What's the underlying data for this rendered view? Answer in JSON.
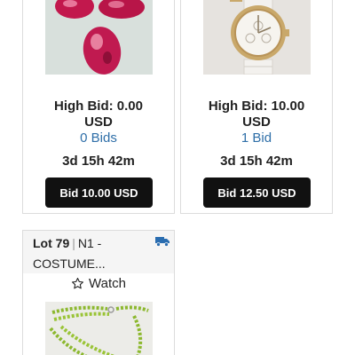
{
  "lots": [
    {
      "image_icon": "ruby-gemstones-photo",
      "high_bid_label": "High Bid: 0.00",
      "currency": "USD",
      "bids": "0 Bids",
      "time_left": "3d 15h 42m",
      "bid_button": "Bid 10.00 USD"
    },
    {
      "image_icon": "wristwatch-photo",
      "high_bid_label": "High Bid: 10.00",
      "currency": "USD",
      "bids": "1 Bid",
      "time_left": "3d 15h 42m",
      "bid_button": "Bid 12.50 USD"
    },
    {
      "lot_number": "Lot 79",
      "title_line1": "N1 -",
      "title_line2": "COSTUME...",
      "shipping_icon": "truck-icon",
      "watch_icon": "star-outline-icon",
      "watch_label": "Watch",
      "image_icon": "green-bead-necklace-photo"
    }
  ],
  "colors": {
    "bid_link": "#2f6fa8",
    "button_bg": "#111111",
    "truck_icon": "#2a6db0"
  }
}
